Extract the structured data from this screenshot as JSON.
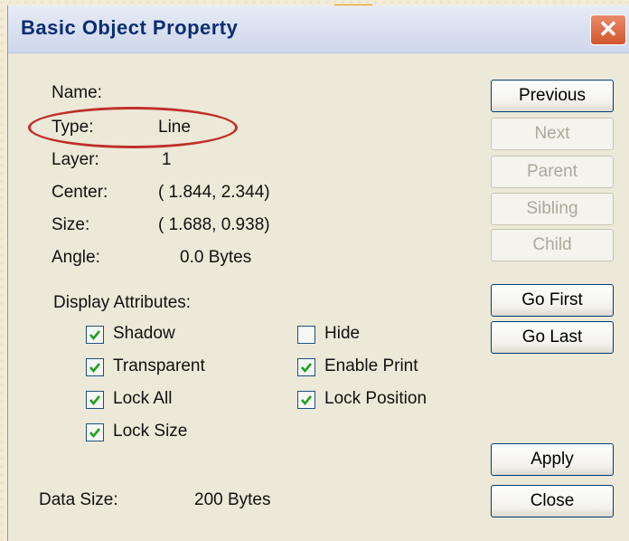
{
  "window": {
    "title": "Basic Object Property",
    "close_symbol": "✕"
  },
  "properties": {
    "name_label": "Name:",
    "type_label": "Type:",
    "type_value": "Line",
    "layer_label": "Layer:",
    "layer_value": "1",
    "center_label": "Center:",
    "center_value": "( 1.844,  2.344)",
    "size_label": "Size:",
    "size_value": "( 1.688,  0.938)",
    "angle_label": "Angle:",
    "angle_value": "0.0 Bytes"
  },
  "display_attributes": {
    "label": "Display Attributes:",
    "options": [
      {
        "label": "Shadow",
        "checked": true
      },
      {
        "label": "Transparent",
        "checked": true
      },
      {
        "label": "Lock All",
        "checked": true
      },
      {
        "label": "Lock Size",
        "checked": true
      },
      {
        "label": "Hide",
        "checked": false
      },
      {
        "label": "Enable Print",
        "checked": true
      },
      {
        "label": "Lock Position",
        "checked": true
      }
    ]
  },
  "data_size": {
    "label": "Data Size:",
    "value": "200 Bytes"
  },
  "buttons": {
    "previous": "Previous",
    "next": "Next",
    "parent": "Parent",
    "sibling": "Sibling",
    "child": "Child",
    "go_first": "Go First",
    "go_last": "Go Last",
    "apply": "Apply",
    "close": "Close"
  },
  "colors": {
    "title_text": "#0a2d73",
    "annotation": "#c0302a",
    "checkmark": "#21a121",
    "close_button": "#d3562e"
  }
}
